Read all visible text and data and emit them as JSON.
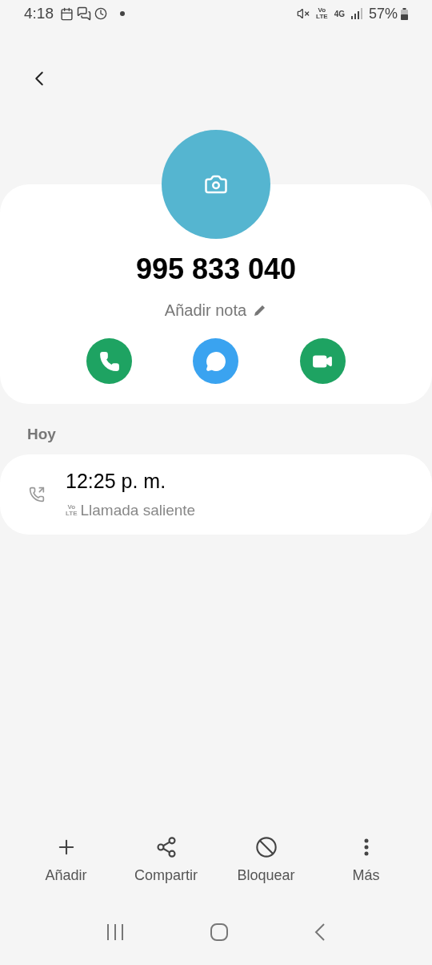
{
  "status_bar": {
    "time": "4:18",
    "volte_top": "Vo",
    "volte_bottom": "LTE",
    "network": "4G",
    "battery": "57%"
  },
  "contact": {
    "number": "995 833 040",
    "note_placeholder": "Añadir nota"
  },
  "quick_actions": [
    {
      "kind": "call"
    },
    {
      "kind": "message"
    },
    {
      "kind": "video"
    }
  ],
  "history": {
    "heading": "Hoy",
    "entries": [
      {
        "kind": "outgoing",
        "time": "12:25 p. m.",
        "volte_top": "Vo",
        "volte_bottom": "LTE",
        "label": "Llamada saliente"
      }
    ]
  },
  "bottom_actions": [
    {
      "kind": "add",
      "label": "Añadir"
    },
    {
      "kind": "share",
      "label": "Compartir"
    },
    {
      "kind": "block",
      "label": "Bloquear"
    },
    {
      "kind": "more",
      "label": "Más"
    }
  ]
}
